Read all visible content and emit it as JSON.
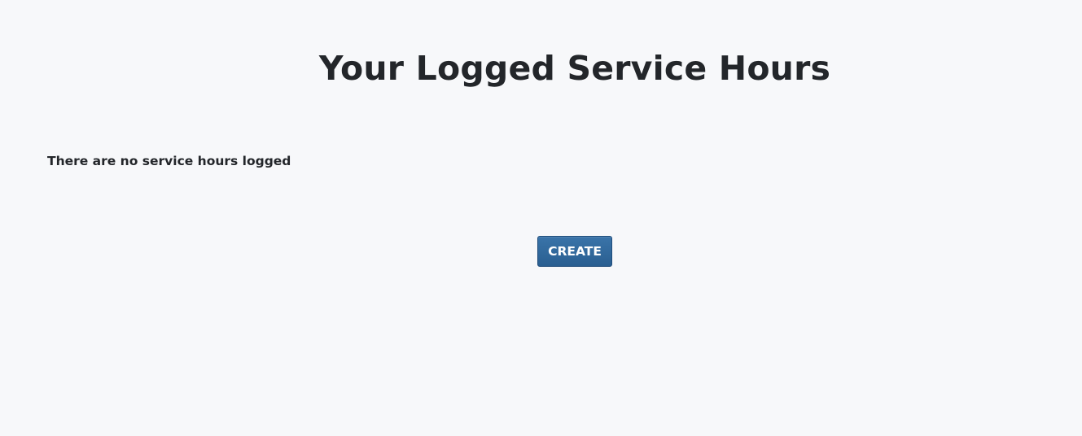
{
  "page": {
    "title": "Your Logged Service Hours",
    "empty_message": "There are no service hours logged",
    "create_button_label": "CREATE"
  },
  "colors": {
    "background": "#f7f8fa",
    "text": "#23262a",
    "button_primary": "#2e6599"
  }
}
